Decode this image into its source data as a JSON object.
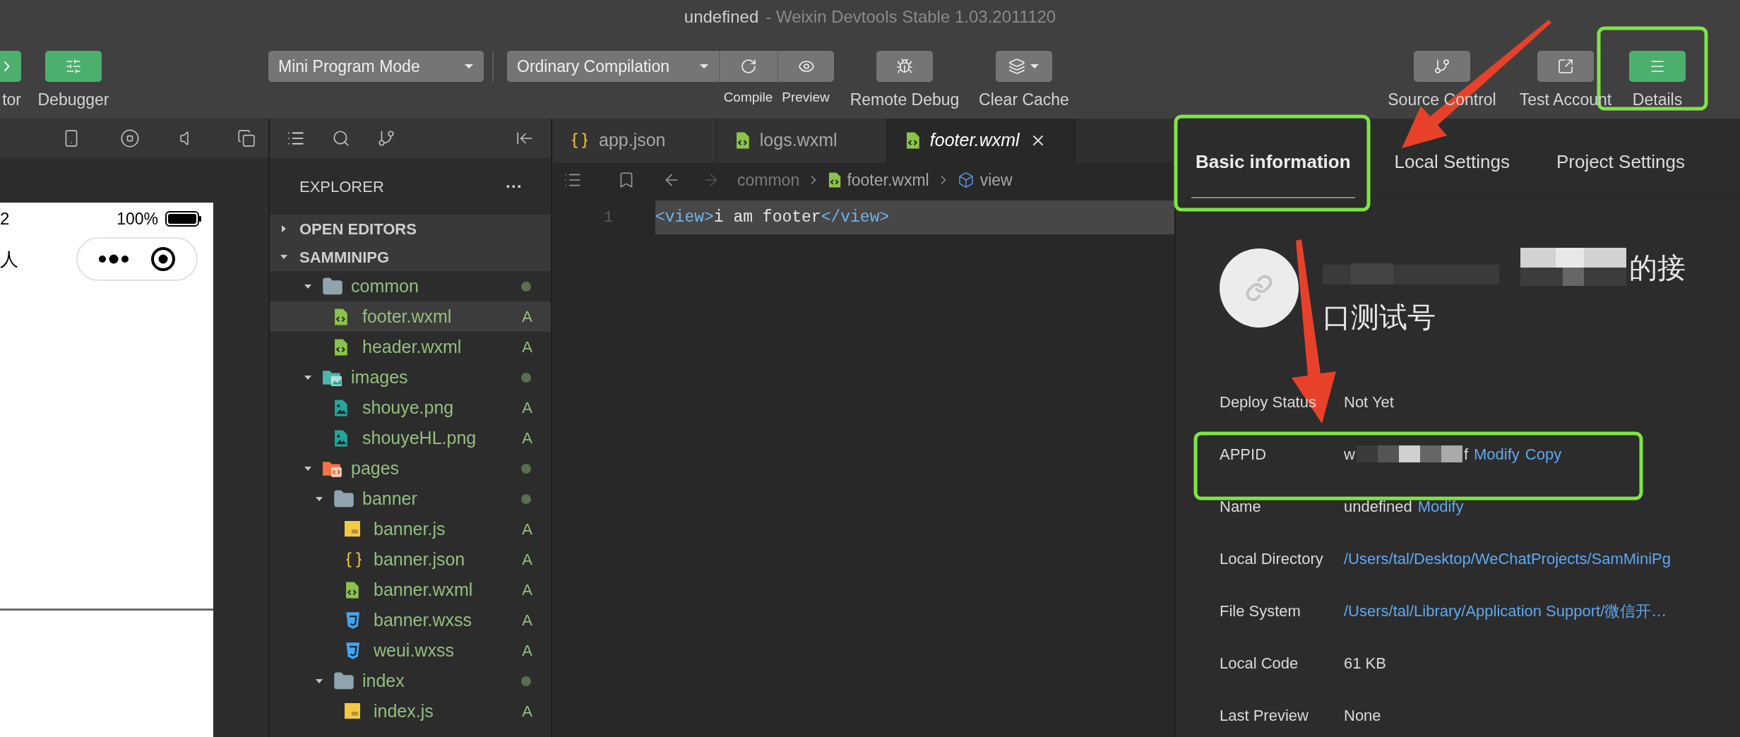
{
  "window": {
    "title": "undefined",
    "subtitle": "- Weixin Devtools Stable 1.03.2011120"
  },
  "toolbar": {
    "view_tools": [
      {
        "label": "tor",
        "on": true
      },
      {
        "label": "Debugger",
        "on": true
      }
    ],
    "mode_dropdown": {
      "value": "Mini Program Mode"
    },
    "compile_dropdown": {
      "value": "Ordinary Compilation"
    },
    "compile_actions": [
      {
        "label": "Compile"
      },
      {
        "label": "Preview"
      }
    ],
    "actions": [
      {
        "label": "Remote Debug"
      },
      {
        "label": "Clear Cache"
      }
    ],
    "right_tools": [
      {
        "label": "Source Control",
        "on": false
      },
      {
        "label": "Test Account",
        "on": false
      },
      {
        "label": "Details",
        "on": true
      }
    ]
  },
  "simulator": {
    "status_time": "2",
    "battery": "100%",
    "nav_title": "人"
  },
  "explorer": {
    "header": "EXPLORER",
    "more": "···",
    "sections": [
      {
        "label": "OPEN EDITORS",
        "expanded": false
      },
      {
        "label": "SAMMINIPG",
        "expanded": true
      }
    ],
    "tree": [
      {
        "name": "common",
        "kind": "folder",
        "expanded": true,
        "selected": false,
        "children": [
          {
            "name": "footer.wxml",
            "kind": "wxml",
            "status": "A",
            "selected": true
          },
          {
            "name": "header.wxml",
            "kind": "wxml",
            "status": "A",
            "selected": false
          }
        ]
      },
      {
        "name": "images",
        "kind": "imagefolder",
        "expanded": true,
        "selected": false,
        "children": [
          {
            "name": "shouye.png",
            "kind": "image",
            "status": "A",
            "selected": false
          },
          {
            "name": "shouyeHL.png",
            "kind": "image",
            "status": "A",
            "selected": false
          }
        ]
      },
      {
        "name": "pages",
        "kind": "pagesfolder",
        "expanded": true,
        "selected": false,
        "children": [
          {
            "name": "banner",
            "kind": "folder",
            "expanded": true,
            "selected": false,
            "children": [
              {
                "name": "banner.js",
                "kind": "js",
                "status": "A",
                "selected": false
              },
              {
                "name": "banner.json",
                "kind": "json",
                "status": "A",
                "selected": false
              },
              {
                "name": "banner.wxml",
                "kind": "wxml",
                "status": "A",
                "selected": false
              },
              {
                "name": "banner.wxss",
                "kind": "wxss",
                "status": "A",
                "selected": false
              },
              {
                "name": "weui.wxss",
                "kind": "wxss",
                "status": "A",
                "selected": false
              }
            ]
          },
          {
            "name": "index",
            "kind": "folder",
            "expanded": true,
            "selected": false,
            "children": [
              {
                "name": "index.js",
                "kind": "js",
                "status": "A",
                "selected": false
              }
            ]
          }
        ]
      }
    ]
  },
  "editor": {
    "tabs": [
      {
        "label": "app.json",
        "kind": "json",
        "selected": false
      },
      {
        "label": "logs.wxml",
        "kind": "wxml",
        "selected": false
      },
      {
        "label": "footer.wxml",
        "kind": "wxml",
        "selected": true
      }
    ],
    "breadcrumb": [
      {
        "label": "common",
        "kind": "folder"
      },
      {
        "label": "footer.wxml",
        "kind": "wxml"
      },
      {
        "label": "view",
        "kind": "element"
      }
    ],
    "lines": [
      {
        "number": "1",
        "highlighted": true,
        "tokens": [
          {
            "text": "<view>",
            "kind": "tag"
          },
          {
            "text": "i am footer",
            "kind": "text"
          },
          {
            "text": "</view>",
            "kind": "tag"
          }
        ]
      }
    ]
  },
  "details": {
    "tabs": [
      {
        "label": "Basic information",
        "selected": true
      },
      {
        "label": "Local Settings",
        "selected": false
      },
      {
        "label": "Project Settings",
        "selected": false
      }
    ],
    "app_name_lines": [
      "的接",
      "口测试号"
    ],
    "name_redacted": true,
    "rows": [
      {
        "label": "Deploy Status",
        "value": "Not Yet",
        "kind": "text"
      },
      {
        "label": "APPID",
        "value": "w",
        "redacted": true,
        "value_end": "f",
        "kind": "text",
        "links": [
          "Modify",
          "Copy"
        ]
      },
      {
        "label": "Name",
        "value": "undefined",
        "kind": "text",
        "links": [
          "Modify"
        ]
      },
      {
        "label": "Local Directory",
        "value": "/Users/tal/Desktop/WeChatProjects/SamMiniPg",
        "kind": "link"
      },
      {
        "label": "File System",
        "value": "/Users/tal/Library/Application Support/微信开…",
        "kind": "link"
      },
      {
        "label": "Local Code",
        "value": "61 KB",
        "kind": "text"
      },
      {
        "label": "Last Preview",
        "value": "None",
        "kind": "text"
      }
    ]
  }
}
